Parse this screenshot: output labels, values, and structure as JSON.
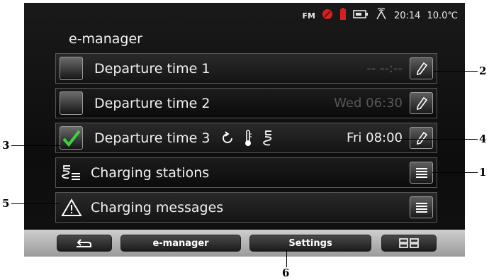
{
  "status": {
    "radio": "FM",
    "time": "20:14",
    "temperature": "10.0℃",
    "colors": {
      "red": "#d92020"
    }
  },
  "header": {
    "title": "e-manager"
  },
  "rows": [
    {
      "label": "Departure time 1",
      "value": "-- --:--",
      "checked": false
    },
    {
      "label": "Departure time 2",
      "value": "Wed 06:30",
      "checked": false
    },
    {
      "label": "Departure time 3",
      "value": "Fri 08:00",
      "checked": true
    },
    {
      "label": "Charging stations"
    },
    {
      "label": "Charging messages"
    }
  ],
  "bottom": {
    "back_icon": "back-icon",
    "emanager": "e-manager",
    "settings": "Settings",
    "grid_icon": "grid-icon"
  },
  "callouts": {
    "c1": "1",
    "c2": "2",
    "c3": "3",
    "c4": "4",
    "c5": "5",
    "c6": "6"
  }
}
